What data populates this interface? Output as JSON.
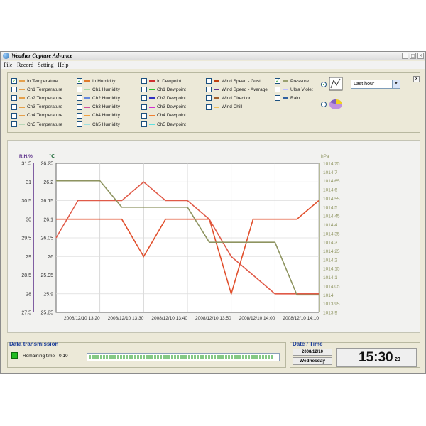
{
  "window": {
    "title": "Weather Capture Advance"
  },
  "menu": [
    "File",
    "Record",
    "Setting",
    "Help"
  ],
  "options": {
    "columns": [
      [
        {
          "label": "In Temperature",
          "checked": true,
          "color": "#e5a04a"
        },
        {
          "label": "Ch1 Temperature",
          "checked": false,
          "color": "#e5a04a"
        },
        {
          "label": "Ch2 Temperature",
          "checked": false,
          "color": "#e5a04a"
        },
        {
          "label": "Ch3 Temperature",
          "checked": false,
          "color": "#e5a04a"
        },
        {
          "label": "Ch4 Temperature",
          "checked": false,
          "color": "#e5a04a"
        },
        {
          "label": "Ch5 Temperature",
          "checked": false,
          "color": "#b7d7b7"
        }
      ],
      [
        {
          "label": "In Humidity",
          "checked": true,
          "color": "#e07a2a"
        },
        {
          "label": "Ch1 Humidity",
          "checked": false,
          "color": "#a8d8a0"
        },
        {
          "label": "Ch2 Humidity",
          "checked": false,
          "color": "#6688dd"
        },
        {
          "label": "Ch3 Humidity",
          "checked": false,
          "color": "#d050a0"
        },
        {
          "label": "Ch4 Humidity",
          "checked": false,
          "color": "#f0a040"
        },
        {
          "label": "Ch5 Humidity",
          "checked": false,
          "color": "#a0e0e0"
        }
      ],
      [
        {
          "label": "In Dewpoint",
          "checked": false,
          "color": "#d03030"
        },
        {
          "label": "Ch1 Dewpoint",
          "checked": false,
          "color": "#30c030"
        },
        {
          "label": "Ch2 Dewpoint",
          "checked": false,
          "color": "#3030c0"
        },
        {
          "label": "Ch3 Dewpoint",
          "checked": false,
          "color": "#d030d0"
        },
        {
          "label": "Ch4 Dewpoint",
          "checked": false,
          "color": "#f08030"
        },
        {
          "label": "Ch5 Dewpoint",
          "checked": false,
          "color": "#60e0e0"
        }
      ],
      [
        {
          "label": "Wind Speed - Gust",
          "checked": false,
          "color": "#c04010"
        },
        {
          "label": "Wind Speed - Average",
          "checked": false,
          "color": "#603090"
        },
        {
          "label": "Wind Direction",
          "checked": false,
          "color": "#a06030"
        },
        {
          "label": "Wind Chill",
          "checked": false,
          "color": "#f0c060"
        }
      ],
      [
        {
          "label": "Pressure",
          "checked": true,
          "color": "#9aa070"
        },
        {
          "label": "Ultra Violet",
          "checked": false,
          "color": "#c0c0ff"
        },
        {
          "label": "Rain",
          "checked": false,
          "color": "#3060a0"
        }
      ]
    ],
    "chart_type_selected": "line",
    "period": "Last hour"
  },
  "chart_data": {
    "type": "line",
    "x": [
      "2008/12/10 13:20",
      "2008/12/10 13:30",
      "2008/12/10 13:40",
      "2008/12/10 13:50",
      "2008/12/10 14:00",
      "2008/12/10 14:10"
    ],
    "axes": {
      "humidity": {
        "label": "R.H.%",
        "ticks": [
          "31.5",
          "31",
          "30.5",
          "30",
          "29.5",
          "29",
          "28.5",
          "28",
          "27.5"
        ],
        "ylim": [
          27.5,
          31.5
        ],
        "color": "#5a2d88"
      },
      "temperature": {
        "label": "℃",
        "ticks": [
          "26.25",
          "26.2",
          "26.15",
          "26.1",
          "26.05",
          "26",
          "25.95",
          "25.9",
          "25.85"
        ],
        "ylim": [
          25.85,
          26.25
        ],
        "color": "#1f6b3a"
      },
      "pressure": {
        "label": "hPa",
        "ticks": [
          "1014.75",
          "1014.7",
          "1014.65",
          "1014.6",
          "1014.55",
          "1014.5",
          "1014.45",
          "1014.4",
          "1014.35",
          "1014.3",
          "1014.25",
          "1014.2",
          "1014.15",
          "1014.1",
          "1014.05",
          "1014",
          "1013.95",
          "1013.9"
        ],
        "ylim": [
          1013.9,
          1014.75
        ],
        "color": "#8e9460"
      }
    },
    "series": [
      {
        "axis": "temperature",
        "color": "#e14f2c",
        "points": [
          [
            0,
            26.1
          ],
          [
            1.5,
            26.1
          ],
          [
            2.0,
            26.0
          ],
          [
            2.5,
            26.1
          ],
          [
            3.5,
            26.1
          ],
          [
            4.0,
            25.9
          ],
          [
            4.5,
            26.1
          ],
          [
            5.5,
            26.1
          ],
          [
            6.0,
            26.15
          ]
        ]
      },
      {
        "axis": "humidity",
        "color": "#e05a48",
        "points": [
          [
            0,
            29.5
          ],
          [
            0.5,
            30.5
          ],
          [
            1.5,
            30.5
          ],
          [
            2.0,
            31.0
          ],
          [
            2.5,
            30.5
          ],
          [
            3.0,
            30.5
          ],
          [
            3.5,
            30.0
          ],
          [
            4.0,
            29.0
          ],
          [
            5.0,
            28.0
          ],
          [
            6.0,
            28.0
          ]
        ]
      },
      {
        "axis": "pressure",
        "color": "#8e9460",
        "points": [
          [
            0,
            1014.65
          ],
          [
            1.0,
            1014.65
          ],
          [
            1.5,
            1014.5
          ],
          [
            3.0,
            1014.5
          ],
          [
            3.5,
            1014.3
          ],
          [
            5.0,
            1014.3
          ],
          [
            5.5,
            1014.0
          ],
          [
            6.0,
            1014.0
          ]
        ]
      }
    ],
    "grid": true
  },
  "status": {
    "transmission_title": "Data transmission",
    "remaining_label": "Remaining time",
    "remaining_value": "0:10",
    "progress": 0.97,
    "datetime_title": "Date / Time",
    "date": "2008/12/10",
    "weekday": "Wednesday",
    "time": "15:30",
    "seconds": "23"
  }
}
